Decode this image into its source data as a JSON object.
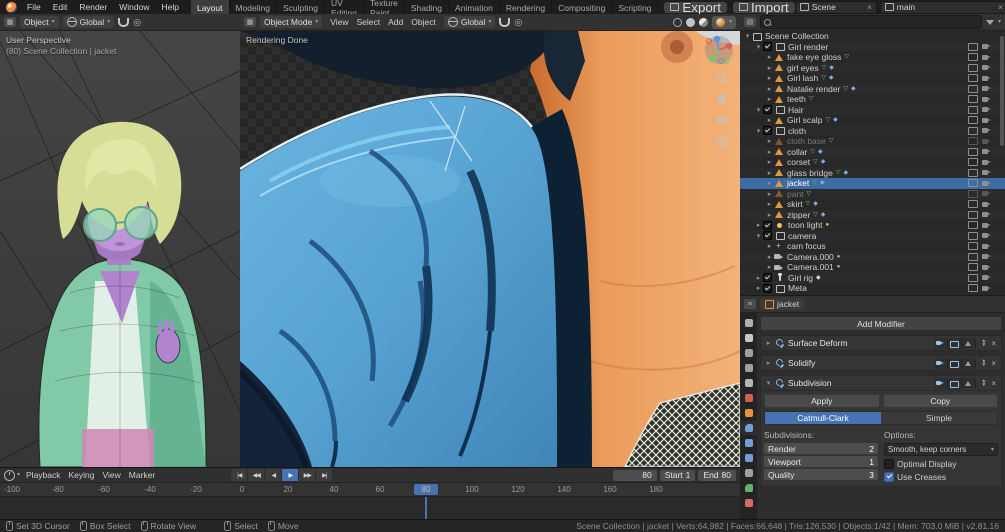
{
  "menubar": {
    "app_menus": [
      "File",
      "Edit",
      "Render",
      "Window",
      "Help"
    ],
    "workspaces": [
      "Layout",
      "Modeling",
      "Sculpting",
      "UV Editing",
      "Texture Paint",
      "Shading",
      "Animation",
      "Rendering",
      "Compositing",
      "Scripting"
    ],
    "active_workspace": "Layout",
    "export_label": "Export",
    "import_label": "Import",
    "scene_field": "Scene",
    "view_layer_field": "main"
  },
  "viewport_left": {
    "header": {
      "mode_label": "Object",
      "orientation": "Global"
    },
    "overlay": {
      "line1": "User Perspective",
      "line2": "(80) Scene Collection | jacket"
    }
  },
  "viewport_center": {
    "header": {
      "mode_label": "Object Mode",
      "menus": [
        "View",
        "Select",
        "Add",
        "Object"
      ],
      "orientation": "Global"
    },
    "overlay": {
      "line1": "Rendering Done"
    }
  },
  "outliner": {
    "rows": [
      {
        "label": "Scene Collection",
        "depth": 0,
        "icon": "collection",
        "arrow": "open",
        "checkbox": null,
        "selected": false,
        "dimmed": false,
        "badges": []
      },
      {
        "label": "Girl render",
        "depth": 1,
        "icon": "collection",
        "arrow": "open",
        "checkbox": true,
        "selected": false,
        "dimmed": false,
        "badges": []
      },
      {
        "label": "fake eye gloss",
        "depth": 2,
        "icon": "mesh",
        "arrow": "closed",
        "checkbox": null,
        "selected": false,
        "dimmed": false,
        "badges": [
          "mesh-data"
        ]
      },
      {
        "label": "girl eyes",
        "depth": 2,
        "icon": "mesh",
        "arrow": "closed",
        "checkbox": null,
        "selected": false,
        "dimmed": false,
        "badges": [
          "mesh-data",
          "modifier"
        ]
      },
      {
        "label": "Girl lash",
        "depth": 2,
        "icon": "mesh",
        "arrow": "closed",
        "checkbox": null,
        "selected": false,
        "dimmed": false,
        "badges": [
          "mesh-data",
          "modifier"
        ]
      },
      {
        "label": "Natalie render",
        "depth": 2,
        "icon": "mesh",
        "arrow": "closed",
        "checkbox": null,
        "selected": false,
        "dimmed": false,
        "badges": [
          "mesh-data",
          "modifier"
        ]
      },
      {
        "label": "teeth",
        "depth": 2,
        "icon": "mesh",
        "arrow": "closed",
        "checkbox": null,
        "selected": false,
        "dimmed": false,
        "badges": [
          "mesh-data"
        ]
      },
      {
        "label": "Hair",
        "depth": 1,
        "icon": "collection",
        "arrow": "open",
        "checkbox": true,
        "selected": false,
        "dimmed": false,
        "badges": []
      },
      {
        "label": "Girl scalp",
        "depth": 2,
        "icon": "mesh",
        "arrow": "closed",
        "checkbox": null,
        "selected": false,
        "dimmed": false,
        "badges": [
          "mesh-data",
          "modifier"
        ]
      },
      {
        "label": "cloth",
        "depth": 1,
        "icon": "collection",
        "arrow": "open",
        "checkbox": true,
        "selected": false,
        "dimmed": false,
        "badges": []
      },
      {
        "label": "cloth base",
        "depth": 2,
        "icon": "mesh",
        "arrow": "closed",
        "checkbox": null,
        "selected": false,
        "dimmed": true,
        "badges": [
          "mesh-data"
        ]
      },
      {
        "label": "collar",
        "depth": 2,
        "icon": "mesh",
        "arrow": "closed",
        "checkbox": null,
        "selected": false,
        "dimmed": false,
        "badges": [
          "mesh-data",
          "modifier"
        ]
      },
      {
        "label": "corset",
        "depth": 2,
        "icon": "mesh",
        "arrow": "closed",
        "checkbox": null,
        "selected": false,
        "dimmed": false,
        "badges": [
          "mesh-data",
          "modifier"
        ]
      },
      {
        "label": "glass bridge",
        "depth": 2,
        "icon": "mesh",
        "arrow": "closed",
        "checkbox": null,
        "selected": false,
        "dimmed": false,
        "badges": [
          "mesh-data",
          "modifier"
        ]
      },
      {
        "label": "jacket",
        "depth": 2,
        "icon": "mesh",
        "arrow": "closed",
        "checkbox": null,
        "selected": true,
        "dimmed": false,
        "badges": [
          "mesh-data",
          "modifier"
        ]
      },
      {
        "label": "pant",
        "depth": 2,
        "icon": "mesh",
        "arrow": "closed",
        "checkbox": null,
        "selected": false,
        "dimmed": true,
        "badges": [
          "mesh-data"
        ]
      },
      {
        "label": "skirt",
        "depth": 2,
        "icon": "mesh",
        "arrow": "closed",
        "checkbox": null,
        "selected": false,
        "dimmed": false,
        "badges": [
          "mesh-data",
          "modifier"
        ]
      },
      {
        "label": "zipper",
        "depth": 2,
        "icon": "mesh",
        "arrow": "closed",
        "checkbox": null,
        "selected": false,
        "dimmed": false,
        "badges": [
          "mesh-data",
          "modifier"
        ]
      },
      {
        "label": "toon light",
        "depth": 1,
        "icon": "light",
        "arrow": "closed",
        "checkbox": true,
        "selected": false,
        "dimmed": false,
        "badges": [
          "light-data"
        ]
      },
      {
        "label": "camera",
        "depth": 1,
        "icon": "collection",
        "arrow": "open",
        "checkbox": true,
        "selected": false,
        "dimmed": false,
        "badges": []
      },
      {
        "label": "cam focus",
        "depth": 2,
        "icon": "empty",
        "arrow": "closed",
        "checkbox": null,
        "selected": false,
        "dimmed": false,
        "badges": []
      },
      {
        "label": "Camera.000",
        "depth": 2,
        "icon": "camera",
        "arrow": "closed",
        "checkbox": null,
        "selected": false,
        "dimmed": false,
        "badges": [
          "camera-data"
        ]
      },
      {
        "label": "Camera.001",
        "depth": 2,
        "icon": "camera",
        "arrow": "closed",
        "checkbox": null,
        "selected": false,
        "dimmed": false,
        "badges": [
          "camera-data"
        ]
      },
      {
        "label": "Girl rig",
        "depth": 1,
        "icon": "armature",
        "arrow": "closed",
        "checkbox": true,
        "selected": false,
        "dimmed": false,
        "badges": [
          "armature-data"
        ]
      },
      {
        "label": "Meta",
        "depth": 1,
        "icon": "collection",
        "arrow": "closed",
        "checkbox": true,
        "selected": false,
        "dimmed": false,
        "badges": []
      }
    ]
  },
  "properties": {
    "tabs": [
      {
        "name": "tool",
        "color": "#b0b0b0",
        "active": false
      },
      {
        "name": "render",
        "color": "#c8c8c8",
        "active": false
      },
      {
        "name": "output",
        "color": "#a0a0a0",
        "active": false
      },
      {
        "name": "view-layer",
        "color": "#a0a0a0",
        "active": false
      },
      {
        "name": "scene",
        "color": "#b4b4b4",
        "active": false
      },
      {
        "name": "world",
        "color": "#cc5f4f",
        "active": false
      },
      {
        "name": "object",
        "color": "#e0953f",
        "active": false
      },
      {
        "name": "modifiers",
        "color": "#6f9fd8",
        "active": true
      },
      {
        "name": "particles",
        "color": "#6f9fd8",
        "active": false
      },
      {
        "name": "physics",
        "color": "#6f9fd8",
        "active": false
      },
      {
        "name": "constraints",
        "color": "#a0a0a0",
        "active": false
      },
      {
        "name": "object-data",
        "color": "#62b36a",
        "active": false
      },
      {
        "name": "material",
        "color": "#d66a6a",
        "active": false
      }
    ],
    "breadcrumb_object": "jacket",
    "add_modifier_label": "Add Modifier",
    "modifiers": [
      {
        "name": "Surface Deform",
        "expanded": false
      },
      {
        "name": "Solidify",
        "expanded": false
      },
      {
        "name": "Subdivision",
        "expanded": true
      }
    ],
    "subdivision": {
      "apply_label": "Apply",
      "copy_label": "Copy",
      "algorithms": [
        "Catmull-Clark",
        "Simple"
      ],
      "algorithm_active": "Catmull-Clark",
      "subdivisions_label": "Subdivisions:",
      "fields": [
        {
          "label": "Render",
          "value": "2"
        },
        {
          "label": "Viewport",
          "value": "1"
        },
        {
          "label": "Quality",
          "value": "3"
        }
      ],
      "options_label": "Options:",
      "uv_smooth": "Smooth, keep corners",
      "checkboxes": [
        {
          "label": "Optimal Display",
          "checked": false
        },
        {
          "label": "Use Creases",
          "checked": true
        }
      ]
    }
  },
  "timeline": {
    "menus": [
      "Playback",
      "Keying",
      "View",
      "Marker"
    ],
    "playback_controls": [
      {
        "name": "jump-to-start",
        "glyph": "|◀",
        "active": false
      },
      {
        "name": "prev-keyframe",
        "glyph": "◀◀",
        "active": false
      },
      {
        "name": "play-reverse",
        "glyph": "◀",
        "active": false
      },
      {
        "name": "play",
        "glyph": "▶",
        "active": true
      },
      {
        "name": "next-keyframe",
        "glyph": "▶▶",
        "active": false
      },
      {
        "name": "jump-to-end",
        "glyph": "▶|",
        "active": false
      }
    ],
    "current_frame": "80",
    "start_label": "Start",
    "start_value": "1",
    "end_label": "End",
    "end_value": "80",
    "ticks": [
      "-100",
      "-80",
      "-60",
      "-40",
      "-20",
      "0",
      "20",
      "40",
      "60",
      "80",
      "100",
      "120",
      "140",
      "160",
      "180"
    ],
    "playhead": "80",
    "playhead_frame": 80
  },
  "statusbar": {
    "hints": [
      "Set 3D Cursor",
      "Box Select",
      "Rotate View",
      "Select",
      "Move"
    ],
    "stats": "Scene Collection | jacket | Verts:64,982 | Faces:66,648 | Tris:126,530 | Objects:1/42 | Mem: 703.0 MiB | v2.81.16"
  }
}
